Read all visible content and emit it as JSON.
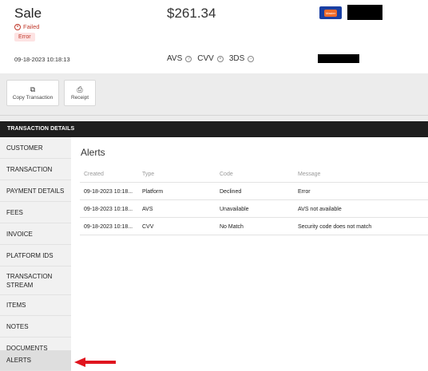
{
  "header": {
    "title": "Sale",
    "status": "Failed",
    "badge": "Error",
    "amount": "$261.34",
    "datetime": "09-18-2023 10:18:13",
    "checks": {
      "avs": "AVS",
      "cvv": "CVV",
      "threeds": "3DS"
    },
    "card_logo_text": "Master"
  },
  "actions": {
    "copy_label": "Copy Transaction",
    "receipt_label": "Receipt"
  },
  "section_title": "TRANSACTION DETAILS",
  "sidebar": {
    "items": [
      {
        "label": "CUSTOMER",
        "active": false
      },
      {
        "label": "TRANSACTION",
        "active": false
      },
      {
        "label": "PAYMENT DETAILS",
        "active": false
      },
      {
        "label": "FEES",
        "active": false
      },
      {
        "label": "INVOICE",
        "active": false
      },
      {
        "label": "PLATFORM IDS",
        "active": false
      },
      {
        "label": "TRANSACTION STREAM",
        "active": false
      },
      {
        "label": "ITEMS",
        "active": false
      },
      {
        "label": "NOTES",
        "active": false
      },
      {
        "label": "DOCUMENTS",
        "active": false
      },
      {
        "label": "ALERTS",
        "active": true
      }
    ]
  },
  "alerts": {
    "title": "Alerts",
    "columns": [
      "Created",
      "Type",
      "Code",
      "Message"
    ],
    "rows": [
      [
        "09-18-2023 10:18...",
        "Platform",
        "Declined",
        "Error"
      ],
      [
        "09-18-2023 10:18...",
        "AVS",
        "Unavailable",
        "AVS not available"
      ],
      [
        "09-18-2023 10:18...",
        "CVV",
        "No Match",
        "Security code does not match"
      ]
    ]
  },
  "colors": {
    "failed": "#c0392b",
    "section_bar": "#1e1e1e",
    "annotation_arrow": "#e0141e"
  }
}
